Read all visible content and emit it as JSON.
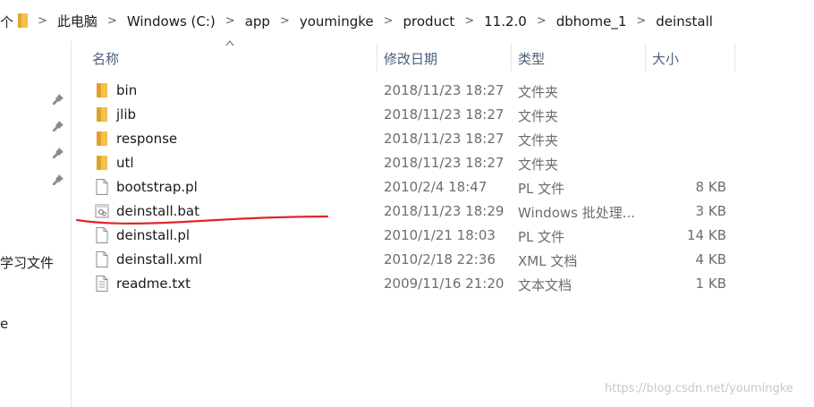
{
  "address": {
    "up_fragment": "个",
    "crumbs": [
      "此电脑",
      "Windows (C:)",
      "app",
      "youmingke",
      "product",
      "11.2.0",
      "dbhome_1",
      "deinstall"
    ]
  },
  "nav": {
    "fragment1": "学习文件",
    "fragment2": "e"
  },
  "headers": {
    "name": "名称",
    "date": "修改日期",
    "type": "类型",
    "size": "大小"
  },
  "files": [
    {
      "name": "bin",
      "date": "2018/11/23 18:27",
      "type": "文件夹",
      "size": "",
      "icon": "folder-icon"
    },
    {
      "name": "jlib",
      "date": "2018/11/23 18:27",
      "type": "文件夹",
      "size": "",
      "icon": "folder-icon"
    },
    {
      "name": "response",
      "date": "2018/11/23 18:27",
      "type": "文件夹",
      "size": "",
      "icon": "folder-icon"
    },
    {
      "name": "utl",
      "date": "2018/11/23 18:27",
      "type": "文件夹",
      "size": "",
      "icon": "folder-icon"
    },
    {
      "name": "bootstrap.pl",
      "date": "2010/2/4 18:47",
      "type": "PL 文件",
      "size": "8 KB",
      "icon": "file-icon"
    },
    {
      "name": "deinstall.bat",
      "date": "2018/11/23 18:29",
      "type": "Windows 批处理...",
      "size": "3 KB",
      "icon": "batch-file-icon"
    },
    {
      "name": "deinstall.pl",
      "date": "2010/1/21 18:03",
      "type": "PL 文件",
      "size": "14 KB",
      "icon": "file-icon"
    },
    {
      "name": "deinstall.xml",
      "date": "2010/2/18 22:36",
      "type": "XML 文档",
      "size": "4 KB",
      "icon": "file-icon"
    },
    {
      "name": "readme.txt",
      "date": "2009/11/16 21:20",
      "type": "文本文档",
      "size": "1 KB",
      "icon": "text-file-icon"
    }
  ],
  "watermark": "https://blog.csdn.net/youmingke",
  "colors": {
    "folder": "#f2c04d",
    "annotation": "#e0262b",
    "header_text": "#4c607a"
  }
}
